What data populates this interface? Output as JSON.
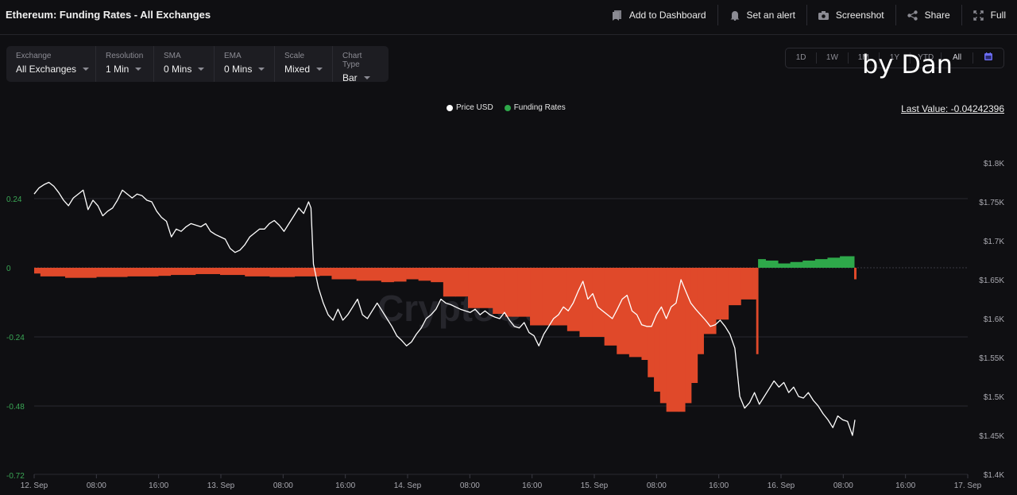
{
  "header": {
    "title": "Ethereum: Funding Rates - All Exchanges",
    "actions": [
      {
        "label": "Add to Dashboard",
        "icon": "bookmark-icon"
      },
      {
        "label": "Set an alert",
        "icon": "bell-icon"
      },
      {
        "label": "Screenshot",
        "icon": "camera-icon"
      },
      {
        "label": "Share",
        "icon": "share-icon"
      },
      {
        "label": "Full",
        "icon": "fullscreen-icon"
      }
    ]
  },
  "controls": [
    {
      "label": "Exchange",
      "value": "All Exchanges"
    },
    {
      "label": "Resolution",
      "value": "1 Min"
    },
    {
      "label": "SMA",
      "value": "0 Mins"
    },
    {
      "label": "EMA",
      "value": "0 Mins"
    },
    {
      "label": "Scale",
      "value": "Mixed"
    },
    {
      "label": "Chart Type",
      "value": "Bar"
    }
  ],
  "ranges": [
    "1D",
    "1W",
    "1M",
    "1Y",
    "YTD",
    "All"
  ],
  "range_calendar_icon": "calendar-icon",
  "overlay_text": "by Dan",
  "legend": [
    {
      "label": "Price USD",
      "color": "#ffffff"
    },
    {
      "label": "Funding Rates",
      "color": "#2ea84a"
    }
  ],
  "last_value": "Last Value: -0.04242396",
  "watermark": "CryptoQuant",
  "colors": {
    "negative": "#e0492a",
    "positive": "#2ea84a",
    "price": "#ffffff",
    "left_axis": "#3aa655",
    "right_axis": "#a9a9b0"
  },
  "chart_data": {
    "type": "bar",
    "title": "Ethereum: Funding Rates - All Exchanges",
    "x_ticks": [
      "12. Sep",
      "08:00",
      "16:00",
      "13. Sep",
      "08:00",
      "16:00",
      "14. Sep",
      "08:00",
      "16:00",
      "15. Sep",
      "08:00",
      "16:00",
      "16. Sep",
      "08:00",
      "16:00",
      "17. Sep"
    ],
    "x_range_hours": [
      0,
      120
    ],
    "left_axis": {
      "label": "Funding Rates",
      "ticks": [
        "0.24",
        "0",
        "-0.24",
        "-0.48",
        "-0.72"
      ],
      "range": [
        -0.72,
        0.48
      ]
    },
    "right_axis": {
      "label": "Price USD",
      "ticks": [
        "$1.8K",
        "$1.75K",
        "$1.7K",
        "$1.65K",
        "$1.6K",
        "$1.55K",
        "$1.5K",
        "$1.45K",
        "$1.4K"
      ],
      "range": [
        1400,
        1800
      ]
    },
    "series": [
      {
        "name": "Funding Rates",
        "type": "bar",
        "points": [
          [
            0,
            -0.02
          ],
          [
            1,
            -0.03
          ],
          [
            3,
            -0.03
          ],
          [
            5,
            -0.035
          ],
          [
            10,
            -0.032
          ],
          [
            15,
            -0.03
          ],
          [
            20,
            -0.028
          ],
          [
            22,
            -0.025
          ],
          [
            26,
            -0.022
          ],
          [
            30,
            -0.025
          ],
          [
            34,
            -0.03
          ],
          [
            38,
            -0.032
          ],
          [
            42,
            -0.03
          ],
          [
            46,
            -0.028
          ],
          [
            48,
            -0.04
          ],
          [
            52,
            -0.045
          ],
          [
            56,
            -0.05
          ],
          [
            58,
            -0.048
          ],
          [
            60,
            -0.04
          ],
          [
            62,
            -0.045
          ],
          [
            64,
            -0.05
          ],
          [
            66,
            -0.1
          ],
          [
            68,
            -0.1
          ],
          [
            70,
            -0.14
          ],
          [
            74,
            -0.16
          ],
          [
            76,
            -0.17
          ],
          [
            78,
            -0.17
          ],
          [
            80,
            -0.2
          ],
          [
            82,
            -0.2
          ],
          [
            86,
            -0.22
          ],
          [
            88,
            -0.24
          ],
          [
            90,
            -0.24
          ],
          [
            92,
            -0.27
          ],
          [
            94,
            -0.3
          ],
          [
            96,
            -0.31
          ],
          [
            98,
            -0.32
          ],
          [
            99,
            -0.38
          ],
          [
            100,
            -0.43
          ],
          [
            101,
            -0.47
          ],
          [
            102,
            -0.5
          ],
          [
            104,
            -0.5
          ],
          [
            105,
            -0.47
          ],
          [
            106,
            -0.4
          ],
          [
            107,
            -0.3
          ],
          [
            108,
            -0.23
          ],
          [
            110,
            -0.18
          ],
          [
            112,
            -0.13
          ],
          [
            114,
            -0.11
          ],
          [
            116,
            -0.11
          ],
          [
            116.5,
            -0.3
          ],
          [
            116.8,
            0.03
          ],
          [
            118,
            0.025
          ],
          [
            120,
            0.015
          ],
          [
            122,
            0.02
          ],
          [
            124,
            0.025
          ],
          [
            126,
            0.03
          ],
          [
            128,
            0.035
          ],
          [
            130,
            0.04
          ],
          [
            132,
            0.04
          ],
          [
            132.3,
            -0.04
          ]
        ]
      },
      {
        "name": "Price USD",
        "type": "line",
        "points": [
          [
            0,
            1760
          ],
          [
            1,
            1768
          ],
          [
            2,
            1772
          ],
          [
            3,
            1775
          ],
          [
            4,
            1770
          ],
          [
            5,
            1762
          ],
          [
            6,
            1752
          ],
          [
            7,
            1745
          ],
          [
            8,
            1755
          ],
          [
            9,
            1760
          ],
          [
            10,
            1765
          ],
          [
            11,
            1740
          ],
          [
            12,
            1752
          ],
          [
            13,
            1745
          ],
          [
            14,
            1732
          ],
          [
            15,
            1738
          ],
          [
            16,
            1742
          ],
          [
            17,
            1752
          ],
          [
            18,
            1765
          ],
          [
            19,
            1760
          ],
          [
            20,
            1755
          ],
          [
            21,
            1760
          ],
          [
            22,
            1758
          ],
          [
            23,
            1752
          ],
          [
            24,
            1750
          ],
          [
            25,
            1738
          ],
          [
            26,
            1730
          ],
          [
            27,
            1725
          ],
          [
            28,
            1705
          ],
          [
            29,
            1715
          ],
          [
            30,
            1712
          ],
          [
            31,
            1718
          ],
          [
            32,
            1722
          ],
          [
            33,
            1720
          ],
          [
            34,
            1718
          ],
          [
            35,
            1722
          ],
          [
            36,
            1712
          ],
          [
            37,
            1708
          ],
          [
            38,
            1705
          ],
          [
            39,
            1702
          ],
          [
            40,
            1690
          ],
          [
            41,
            1685
          ],
          [
            42,
            1688
          ],
          [
            43,
            1695
          ],
          [
            44,
            1705
          ],
          [
            45,
            1710
          ],
          [
            46,
            1715
          ],
          [
            47,
            1715
          ],
          [
            48,
            1722
          ],
          [
            49,
            1726
          ],
          [
            50,
            1720
          ],
          [
            51,
            1712
          ],
          [
            52,
            1722
          ],
          [
            53,
            1732
          ],
          [
            54,
            1742
          ],
          [
            55,
            1735
          ],
          [
            56,
            1750
          ],
          [
            56.5,
            1742
          ],
          [
            57,
            1670
          ],
          [
            58,
            1640
          ],
          [
            59,
            1620
          ],
          [
            60,
            1605
          ],
          [
            61,
            1598
          ],
          [
            62,
            1612
          ],
          [
            63,
            1598
          ],
          [
            64,
            1605
          ],
          [
            65,
            1615
          ],
          [
            66,
            1625
          ],
          [
            67,
            1605
          ],
          [
            68,
            1600
          ],
          [
            69,
            1610
          ],
          [
            70,
            1620
          ],
          [
            71,
            1610
          ],
          [
            72,
            1600
          ],
          [
            73,
            1590
          ],
          [
            74,
            1578
          ],
          [
            75,
            1572
          ],
          [
            76,
            1565
          ],
          [
            77,
            1570
          ],
          [
            78,
            1580
          ],
          [
            79,
            1588
          ],
          [
            80,
            1600
          ],
          [
            81,
            1605
          ],
          [
            82,
            1612
          ],
          [
            83,
            1625
          ],
          [
            84,
            1620
          ],
          [
            85,
            1618
          ],
          [
            86,
            1615
          ],
          [
            87,
            1612
          ],
          [
            88,
            1610
          ],
          [
            89,
            1608
          ],
          [
            90,
            1612
          ],
          [
            91,
            1605
          ],
          [
            92,
            1610
          ],
          [
            93,
            1605
          ],
          [
            94,
            1602
          ],
          [
            95,
            1600
          ],
          [
            96,
            1608
          ],
          [
            97,
            1598
          ],
          [
            98,
            1590
          ],
          [
            99,
            1588
          ],
          [
            100,
            1595
          ],
          [
            101,
            1582
          ],
          [
            102,
            1578
          ],
          [
            103,
            1565
          ],
          [
            104,
            1580
          ],
          [
            105,
            1590
          ],
          [
            106,
            1600
          ],
          [
            107,
            1605
          ],
          [
            108,
            1615
          ],
          [
            109,
            1610
          ],
          [
            110,
            1620
          ],
          [
            111,
            1635
          ],
          [
            112,
            1648
          ],
          [
            113,
            1625
          ],
          [
            114,
            1632
          ],
          [
            115,
            1615
          ],
          [
            116,
            1610
          ],
          [
            117,
            1605
          ],
          [
            118,
            1600
          ],
          [
            119,
            1612
          ],
          [
            120,
            1625
          ],
          [
            121,
            1630
          ],
          [
            122,
            1610
          ],
          [
            123,
            1605
          ],
          [
            124,
            1592
          ],
          [
            125,
            1590
          ],
          [
            126,
            1590
          ],
          [
            127,
            1605
          ],
          [
            128,
            1615
          ],
          [
            129,
            1600
          ],
          [
            130,
            1615
          ],
          [
            131,
            1620
          ],
          [
            132,
            1650
          ],
          [
            133,
            1635
          ],
          [
            134,
            1620
          ],
          [
            135,
            1612
          ],
          [
            136,
            1605
          ],
          [
            137,
            1598
          ],
          [
            138,
            1590
          ],
          [
            139,
            1592
          ],
          [
            140,
            1598
          ],
          [
            141,
            1590
          ],
          [
            142,
            1580
          ],
          [
            143,
            1562
          ],
          [
            144,
            1500
          ],
          [
            145,
            1485
          ],
          [
            146,
            1492
          ],
          [
            147,
            1505
          ],
          [
            148,
            1490
          ],
          [
            149,
            1500
          ],
          [
            150,
            1510
          ],
          [
            151,
            1520
          ],
          [
            152,
            1512
          ],
          [
            153,
            1518
          ],
          [
            154,
            1505
          ],
          [
            155,
            1512
          ],
          [
            156,
            1500
          ],
          [
            157,
            1498
          ],
          [
            158,
            1505
          ],
          [
            159,
            1495
          ],
          [
            160,
            1488
          ],
          [
            161,
            1478
          ],
          [
            162,
            1470
          ],
          [
            163,
            1460
          ],
          [
            164,
            1475
          ],
          [
            165,
            1470
          ],
          [
            166,
            1468
          ],
          [
            167,
            1450
          ],
          [
            167.5,
            1470
          ]
        ]
      }
    ]
  }
}
